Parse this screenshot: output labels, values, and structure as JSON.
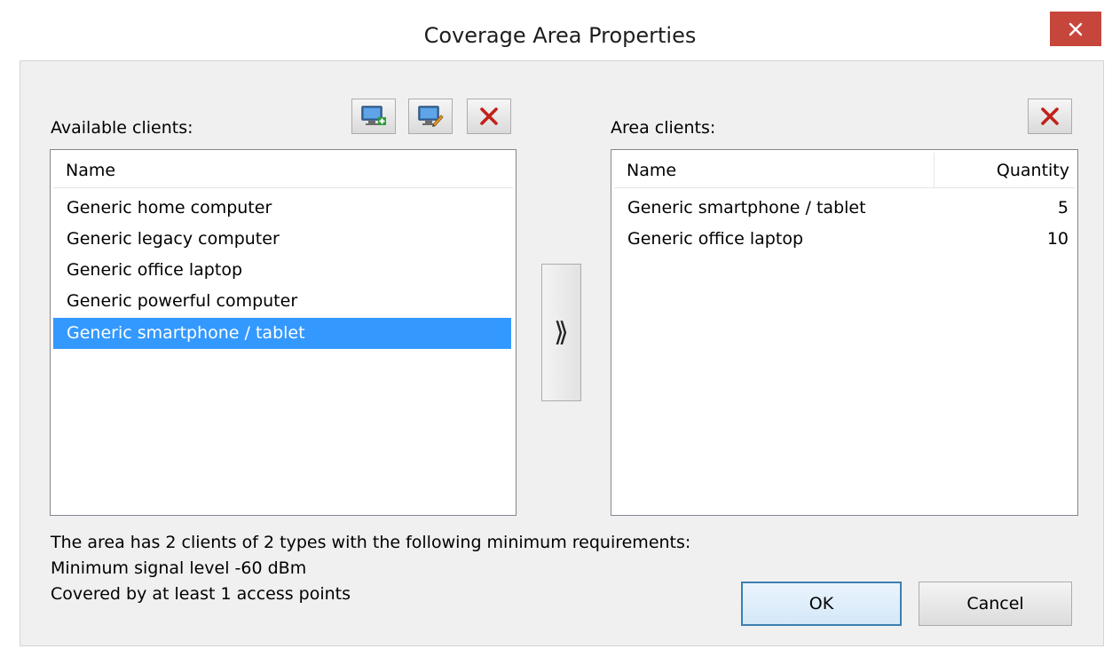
{
  "window": {
    "title": "Coverage Area Properties",
    "close_symbol": "✕"
  },
  "available": {
    "label": "Available clients:",
    "header": "Name",
    "selected_index": 4,
    "items": [
      "Generic home computer",
      "Generic legacy computer",
      "Generic office laptop",
      "Generic powerful computer",
      "Generic smartphone / tablet"
    ],
    "tools": [
      "add-client-icon",
      "edit-client-icon",
      "delete-icon"
    ]
  },
  "move": {
    "symbol": "⟫"
  },
  "area": {
    "label": "Area clients:",
    "header_name": "Name",
    "header_quantity": "Quantity",
    "rows": [
      {
        "name": "Generic smartphone / tablet",
        "quantity": "5"
      },
      {
        "name": "Generic office laptop",
        "quantity": "10"
      }
    ],
    "tools": [
      "delete-icon"
    ]
  },
  "summary": {
    "line1": "The area has 2 clients of 2 types with the following minimum requirements:",
    "line2": "Minimum signal level -60 dBm",
    "line3": "Covered by at least 1 access points"
  },
  "buttons": {
    "ok": "OK",
    "cancel": "Cancel"
  },
  "colors": {
    "close_button": "#c7463c",
    "selection": "#3399ff",
    "delete_x": "#c0221b",
    "default_button_border": "#3c7fb1"
  }
}
